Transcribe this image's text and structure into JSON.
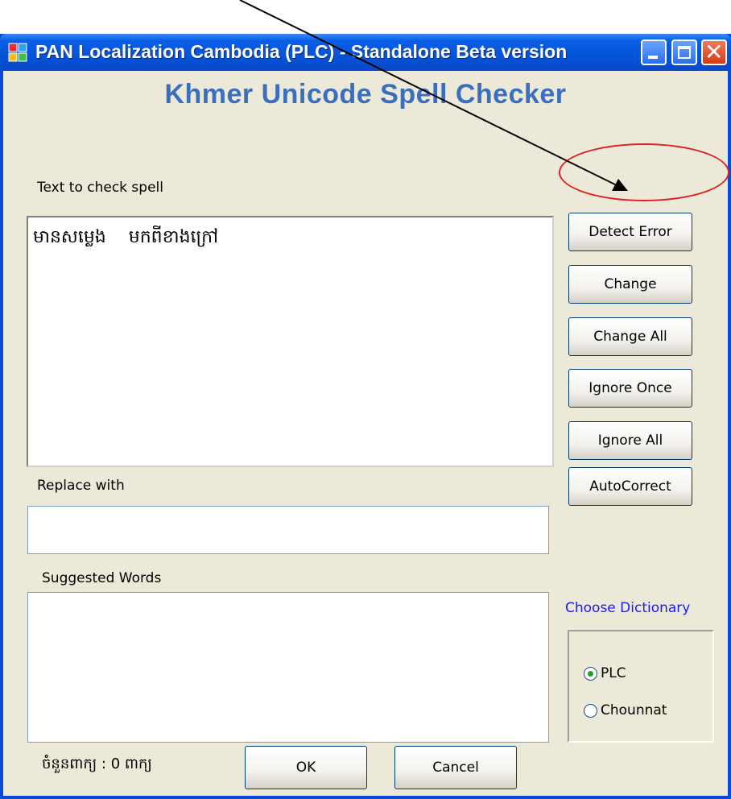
{
  "window": {
    "title": "PAN Localization Cambodia (PLC) - Standalone Beta version"
  },
  "heading": "Khmer Unicode Spell Checker",
  "text_to_check": {
    "label": "Text to check spell",
    "value": "មានសម្លេង    មកពីខាងក្រៅ"
  },
  "buttons": {
    "detect_error": "Detect Error",
    "change": "Change",
    "change_all": "Change All",
    "ignore_once": "Ignore Once",
    "ignore_all": "Ignore All",
    "autocorrect": "AutoCorrect",
    "ok": "OK",
    "cancel": "Cancel"
  },
  "replace_with": {
    "label": "Replace with",
    "value": ""
  },
  "suggested_words": {
    "label": "Suggested Words",
    "items": []
  },
  "dictionary": {
    "label": "Choose Dictionary",
    "options": [
      {
        "label": "PLC",
        "selected": true
      },
      {
        "label": "Chounnat",
        "selected": false
      }
    ]
  },
  "status": "ចំនួនពាក្យ : 0 ពាក្យ",
  "colors": {
    "heading": "#3a6fc0",
    "annotation": "#e02020",
    "dictionary_label": "#1a1aff"
  }
}
